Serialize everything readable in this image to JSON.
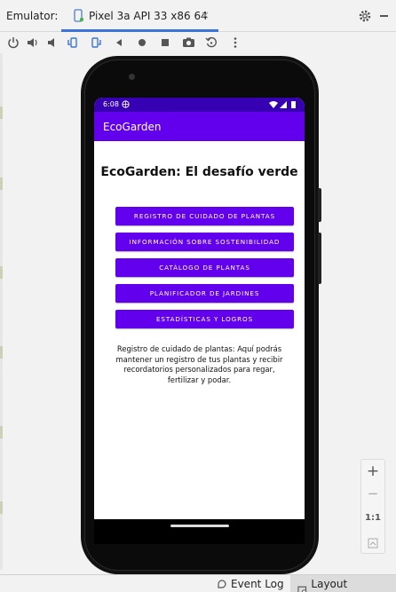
{
  "window": {
    "emulator_label": "Emulator:",
    "tab_title": "Pixel 3a API 33 x86 64",
    "tab_close": "×",
    "settings_icon": "gear-icon"
  },
  "toolbar": {
    "icons": [
      "power-icon",
      "volume-up-icon",
      "volume-down-icon",
      "rotate-left-icon",
      "rotate-right-icon",
      "back-icon",
      "home-icon",
      "overview-icon",
      "camera-icon",
      "reset-icon",
      "more-icon"
    ]
  },
  "device": {
    "status_time": "6:08",
    "app_title": "EcoGarden",
    "heading": "EcoGarden: El desafío verde",
    "buttons": [
      "REGISTRO DE CUIDADO DE PLANTAS",
      "INFORMACIÓN SOBRE SOSTENIBILIDAD",
      "CATÁLOGO DE PLANTAS",
      "PLANIFICADOR DE JARDINES",
      "ESTADÍSTICAS Y LOGROS"
    ],
    "description": "Registro de cuidado de plantas: Aquí podrás mantener un registro de tus plantas y recibir recordatorios personalizados para regar, fertilizar y podar."
  },
  "zoom": {
    "plus": "+",
    "minus": "−",
    "one_to_one": "1:1"
  },
  "bottom_bar": {
    "event_log": "Event Log",
    "layout_inspector": "Layout Inspector"
  },
  "colors": {
    "primary": "#6200ee",
    "primary_dark": "#3700b3",
    "tab_accent": "#3a74d8"
  }
}
